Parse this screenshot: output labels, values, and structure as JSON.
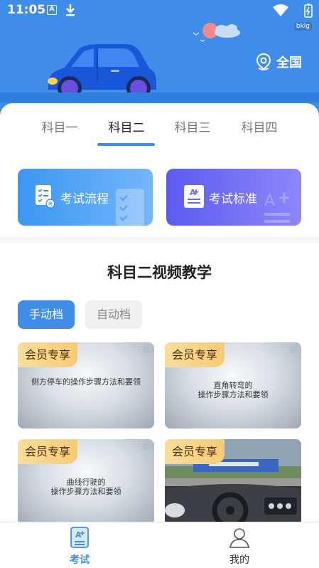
{
  "status_bar": {
    "time": "11:05",
    "badge": "bklg"
  },
  "header": {
    "location_label": "全国"
  },
  "tabs": [
    {
      "label": "科目一"
    },
    {
      "label": "科目二"
    },
    {
      "label": "科目三"
    },
    {
      "label": "科目四"
    }
  ],
  "active_tab": "科目二",
  "quick_buttons": {
    "process": "考试流程",
    "standard": "考试标准"
  },
  "section_title": "科目二视频教学",
  "gear_tabs": {
    "manual": "手动档",
    "auto": "自动档"
  },
  "videos": [
    {
      "badge": "会员专享",
      "title": "侧方停车的操作步骤方法和要领"
    },
    {
      "badge": "会员专享",
      "title_line1": "直角转弯的",
      "title_line2": "操作步骤方法和要领"
    },
    {
      "badge": "会员专享",
      "title_line1": "曲线行驶的",
      "title_line2": "操作步骤方法和要领"
    },
    {
      "badge": "会员专享"
    }
  ],
  "bottom_nav": {
    "exam": "考试",
    "mine": "我的"
  },
  "colors": {
    "primary": "#3f8de9",
    "vip": "#f7cb74",
    "purple": "#6b6af3"
  }
}
